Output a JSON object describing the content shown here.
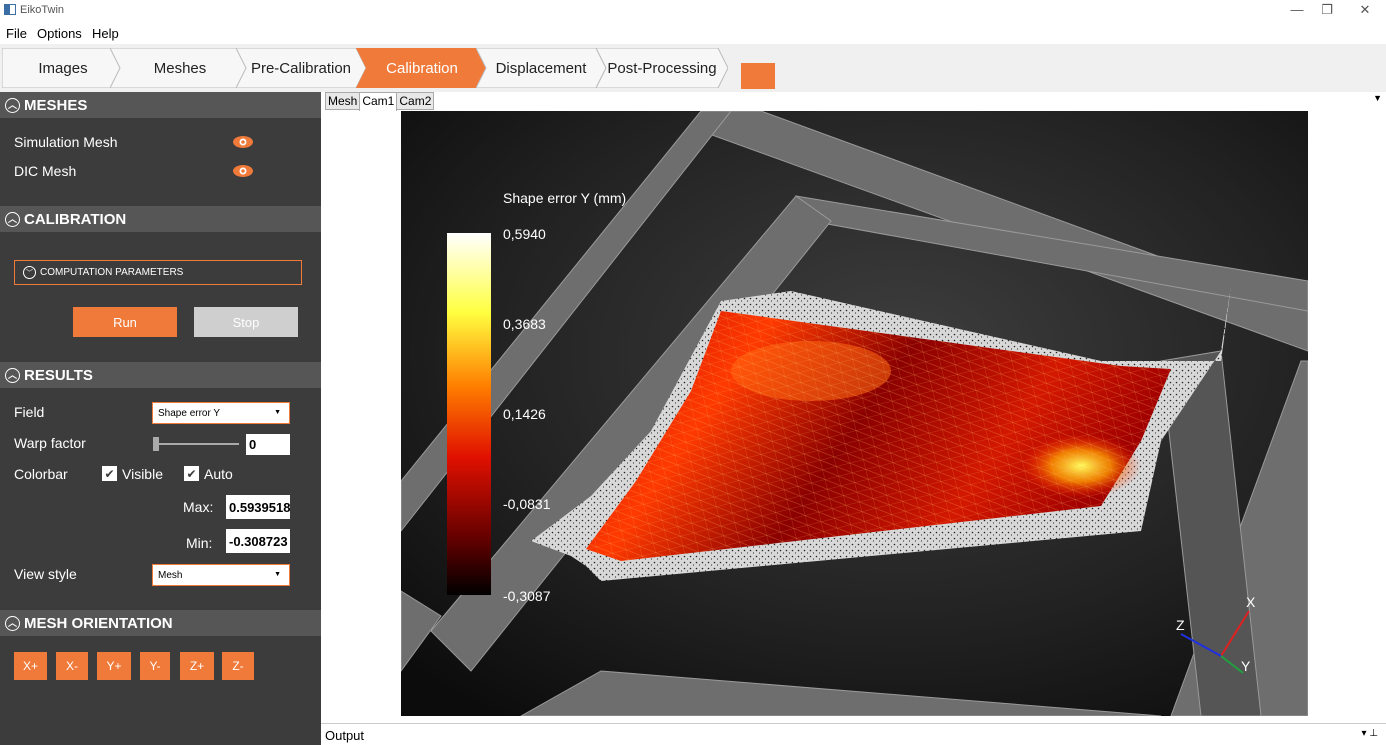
{
  "window": {
    "title": "EikoTwin",
    "controls": [
      "—",
      "❐",
      "✕"
    ]
  },
  "menu": [
    "File",
    "Options",
    "Help"
  ],
  "steps": [
    {
      "label": "Images",
      "active": false
    },
    {
      "label": "Meshes",
      "active": false
    },
    {
      "label": "Pre-Calibration",
      "active": false
    },
    {
      "label": "Calibration",
      "active": true
    },
    {
      "label": "Displacement",
      "active": false
    },
    {
      "label": "Post-Processing",
      "active": false
    }
  ],
  "colors": {
    "accent": "#f07a3a",
    "sidebar_bg": "#3c3c3c",
    "section_bg": "#565656"
  },
  "sidebar": {
    "meshes": {
      "header": "MESHES",
      "items": [
        {
          "label": "Simulation Mesh",
          "icon": "eye-icon"
        },
        {
          "label": "DIC Mesh",
          "icon": "eye-icon"
        }
      ]
    },
    "calibration": {
      "header": "CALIBRATION",
      "computation_parameters": "COMPUTATION PARAMETERS",
      "run_label": "Run",
      "stop_label": "Stop"
    },
    "results": {
      "header": "RESULTS",
      "field_label": "Field",
      "field_value": "Shape error Y",
      "warp_label": "Warp factor",
      "warp_value": "0",
      "colorbar_label": "Colorbar",
      "visible_label": "Visible",
      "auto_label": "Auto",
      "max_label": "Max:",
      "max_value": "0.5939518",
      "min_label": "Min:",
      "min_value": "-0.308723",
      "view_style_label": "View style",
      "view_style_value": "Mesh"
    },
    "orientation": {
      "header": "MESH ORIENTATION",
      "buttons": [
        "X+",
        "X-",
        "Y+",
        "Y-",
        "Z+",
        "Z-"
      ]
    }
  },
  "viewport": {
    "tabs": [
      {
        "label": "Mesh",
        "active": false
      },
      {
        "label": "Cam1",
        "active": true
      },
      {
        "label": "Cam2",
        "active": false
      }
    ],
    "colorbar": {
      "title": "Shape error Y (mm)",
      "ticks": [
        "0,5940",
        "0,3683",
        "0,1426",
        "-0,0831",
        "-0,3087"
      ]
    },
    "axes": {
      "x": "X",
      "y": "Y",
      "z": "Z"
    }
  },
  "output": {
    "label": "Output",
    "controls": "▾ ⊥"
  }
}
